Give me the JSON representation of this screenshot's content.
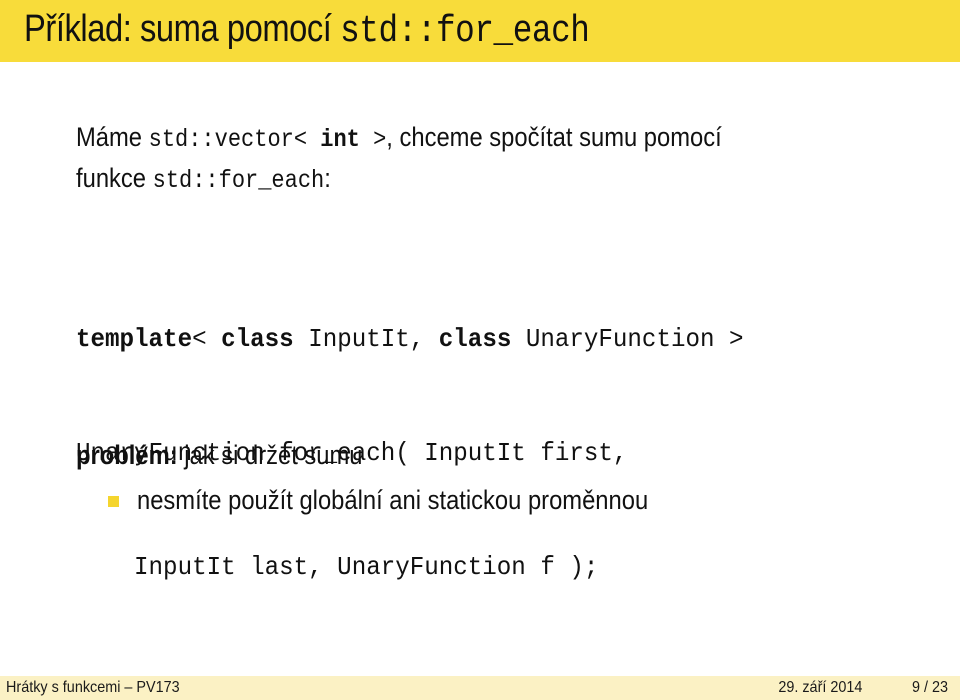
{
  "colors": {
    "title_bar": "#f8dc3a",
    "footer_bar": "#fbf1c4",
    "bullet": "#f5d52e"
  },
  "slide": {
    "title_text": "Příklad: suma pomocí ",
    "title_code": "std::for_each",
    "intro": {
      "t1": "Máme ",
      "c1": "std::vector< ",
      "c1_bold": "int",
      "c2": " >",
      "t2": ", chceme spočítat sumu pomocí",
      "t3": "funkce ",
      "c3": "std::for_each",
      "t4": ":"
    },
    "code": {
      "line1_kw1": "template",
      "line1_p1": "< ",
      "line1_kw2": "class",
      "line1_p2": " InputIt, ",
      "line1_kw3": "class",
      "line1_p3": " UnaryFunction >",
      "line2": "UnaryFunction for_each( InputIt first,",
      "line3": "    InputIt last, UnaryFunction f );"
    },
    "problem_label": "problém:",
    "problem_text": " jak si držet sumu",
    "bullets": [
      "nesmíte použít globální ani statickou proměnnou"
    ]
  },
  "footer": {
    "left": "Hrátky s funkcemi – PV173",
    "date": "29. září 2014",
    "page": "9 / 23"
  }
}
